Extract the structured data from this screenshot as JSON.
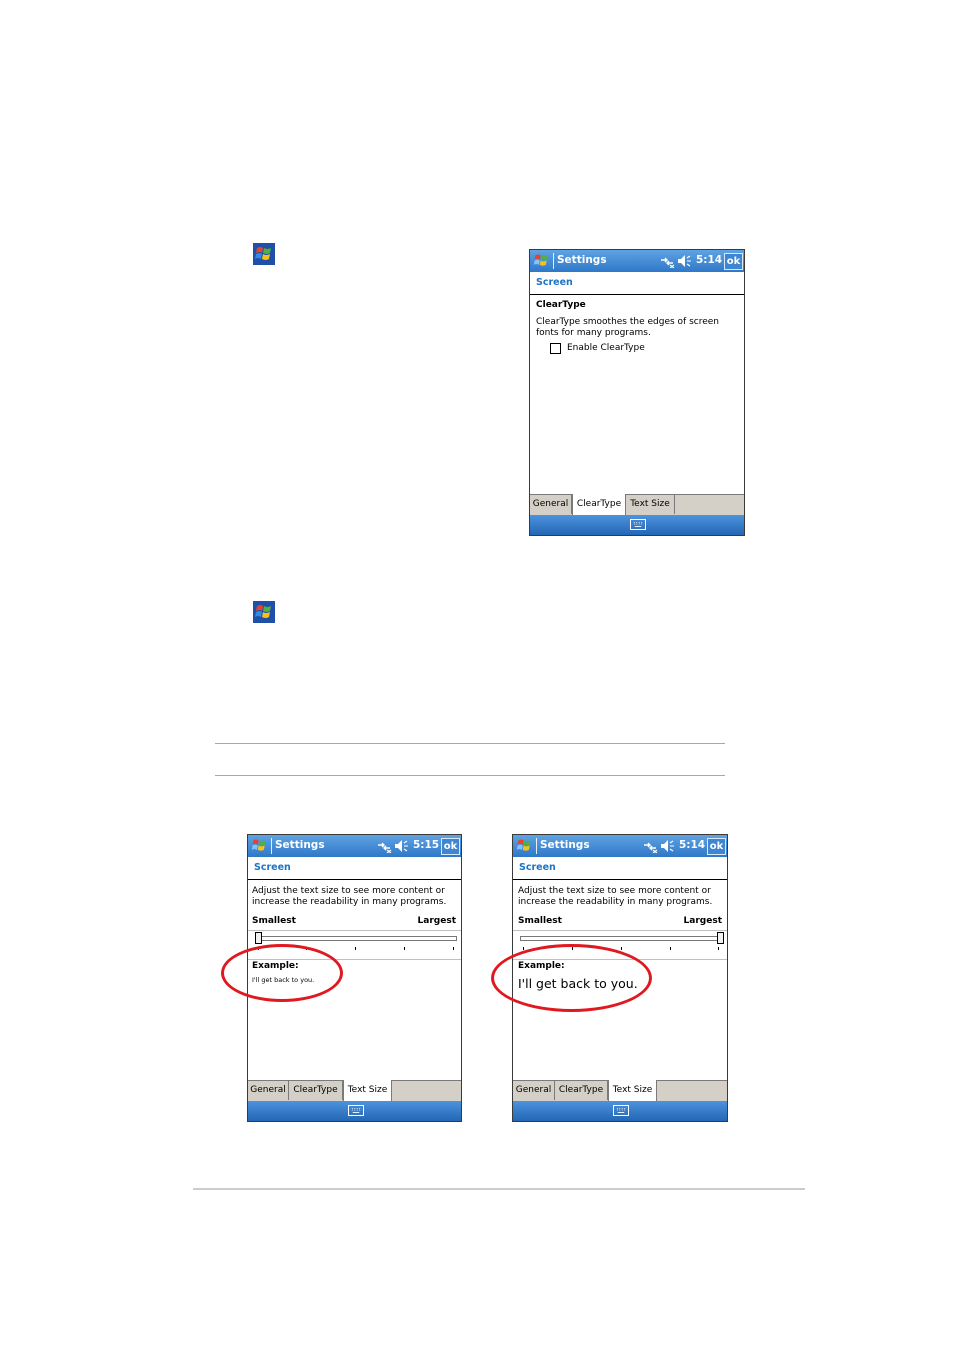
{
  "device1": {
    "title": "Settings",
    "time": "5:14",
    "ok": "ok",
    "header": "Screen",
    "heading": "ClearType",
    "desc_line1": "ClearType smoothes the edges of screen",
    "desc_line2": "fonts for many programs.",
    "checkbox_label": "Enable ClearType",
    "checkbox_checked": false,
    "tabs": [
      "General",
      "ClearType",
      "Text Size"
    ],
    "active_tab": "ClearType"
  },
  "device2": {
    "title": "Settings",
    "time": "5:15",
    "ok": "ok",
    "header": "Screen",
    "desc_line1": "Adjust the text size to see more content or",
    "desc_line2": "increase the readability in many programs.",
    "smallest": "Smallest",
    "largest": "Largest",
    "slider_level": 0,
    "example_label": "Example:",
    "example_text": "I'll get back to you.",
    "tabs": [
      "General",
      "ClearType",
      "Text Size"
    ],
    "active_tab": "Text Size"
  },
  "device3": {
    "title": "Settings",
    "time": "5:14",
    "ok": "ok",
    "header": "Screen",
    "desc_line1": "Adjust the text size to see more content or",
    "desc_line2": "increase the readability in many programs.",
    "smallest": "Smallest",
    "largest": "Largest",
    "slider_level": 1,
    "example_label": "Example:",
    "example_text": "I'll get back to you.",
    "tabs": [
      "General",
      "ClearType",
      "Text Size"
    ],
    "active_tab": "Text Size"
  },
  "icons": {
    "start": "windows-flag-icon",
    "connectivity": "connectivity-icon",
    "volume": "speaker-icon",
    "keyboard": "keyboard-icon"
  },
  "colors": {
    "titlebar": "#3b84d3",
    "header_text": "#1c74c8",
    "highlight_circle": "#e0181f"
  }
}
